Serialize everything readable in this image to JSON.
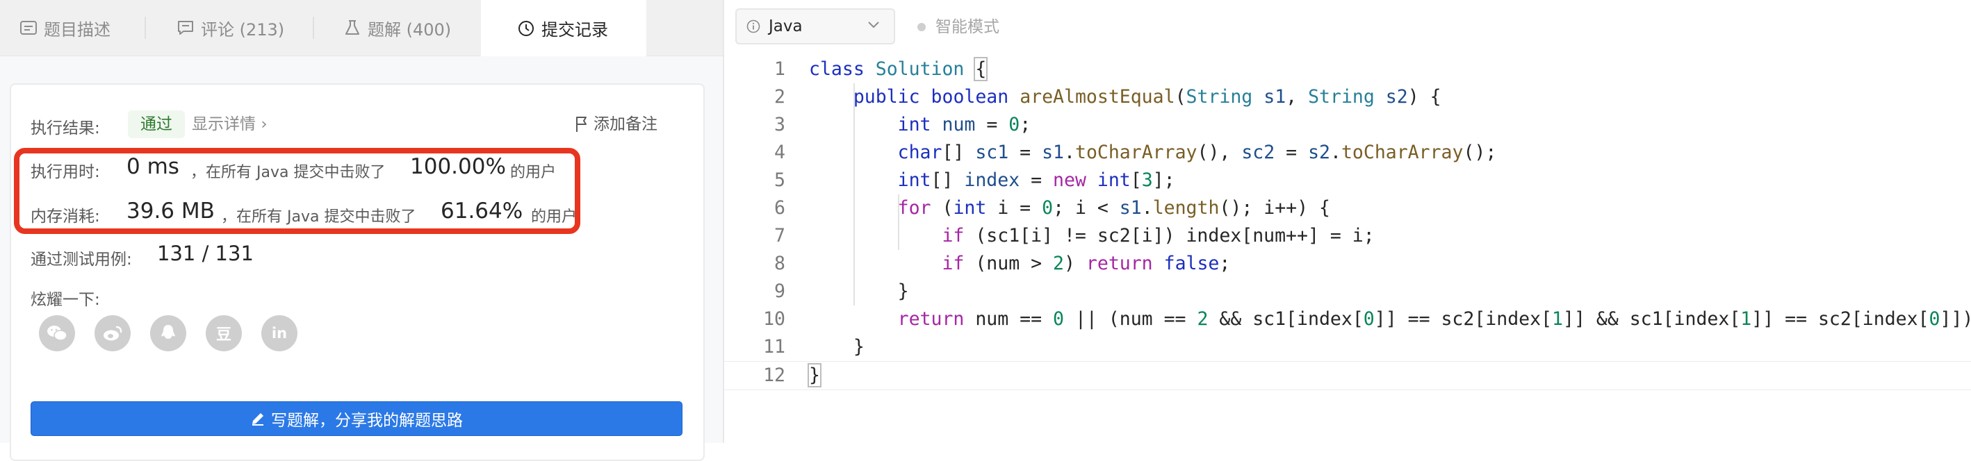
{
  "tabs": [
    {
      "icon": "description-icon",
      "label": "题目描述"
    },
    {
      "icon": "comment-icon",
      "label": "评论 (213)"
    },
    {
      "icon": "flask-icon",
      "label": "题解 (400)"
    },
    {
      "icon": "clock-icon",
      "label": "提交记录"
    }
  ],
  "result": {
    "label": "执行结果:",
    "status": "通过",
    "detail_link": "显示详情",
    "add_note": "添加备注",
    "runtime_label": "执行用时:",
    "runtime_value": "0 ms",
    "runtime_suffix": "，在所有 Java 提交中击败了",
    "runtime_percent": "100.00%",
    "runtime_tail": "的用户",
    "memory_label": "内存消耗:",
    "memory_value": "39.6 MB",
    "memory_suffix": "，在所有 Java 提交中击败了",
    "memory_percent": "61.64%",
    "memory_tail": "的用户",
    "testcases_label": "通过测试用例:",
    "testcases_value": "131 / 131",
    "share_label": "炫耀一下:",
    "social_icons": [
      "wechat-icon",
      "weibo-icon",
      "qq-icon",
      "douban-icon",
      "linkedin-icon"
    ],
    "douban_glyph": "豆",
    "linkedin_glyph": "in",
    "solution_button": "写题解，分享我的解题思路"
  },
  "editor": {
    "language": "Java",
    "smart_mode": "智能模式",
    "highlight_color": "#e8351f",
    "lines": [
      {
        "n": "1",
        "t": "class Solution {"
      },
      {
        "n": "2",
        "t": "    public boolean areAlmostEqual(String s1, String s2) {"
      },
      {
        "n": "3",
        "t": "        int num = 0;"
      },
      {
        "n": "4",
        "t": "        char[] sc1 = s1.toCharArray(), sc2 = s2.toCharArray();"
      },
      {
        "n": "5",
        "t": "        int[] index = new int[3];"
      },
      {
        "n": "6",
        "t": "        for (int i = 0; i < s1.length(); i++) {"
      },
      {
        "n": "7",
        "t": "            if (sc1[i] != sc2[i]) index[num++] = i;"
      },
      {
        "n": "8",
        "t": "            if (num > 2) return false;"
      },
      {
        "n": "9",
        "t": "        }"
      },
      {
        "n": "10",
        "t": "        return num == 0 || (num == 2 && sc1[index[0]] == sc2[index[1]] && sc1[index[1]] == sc2[index[0]]);"
      },
      {
        "n": "11",
        "t": "    }"
      },
      {
        "n": "12",
        "t": "}"
      }
    ]
  }
}
